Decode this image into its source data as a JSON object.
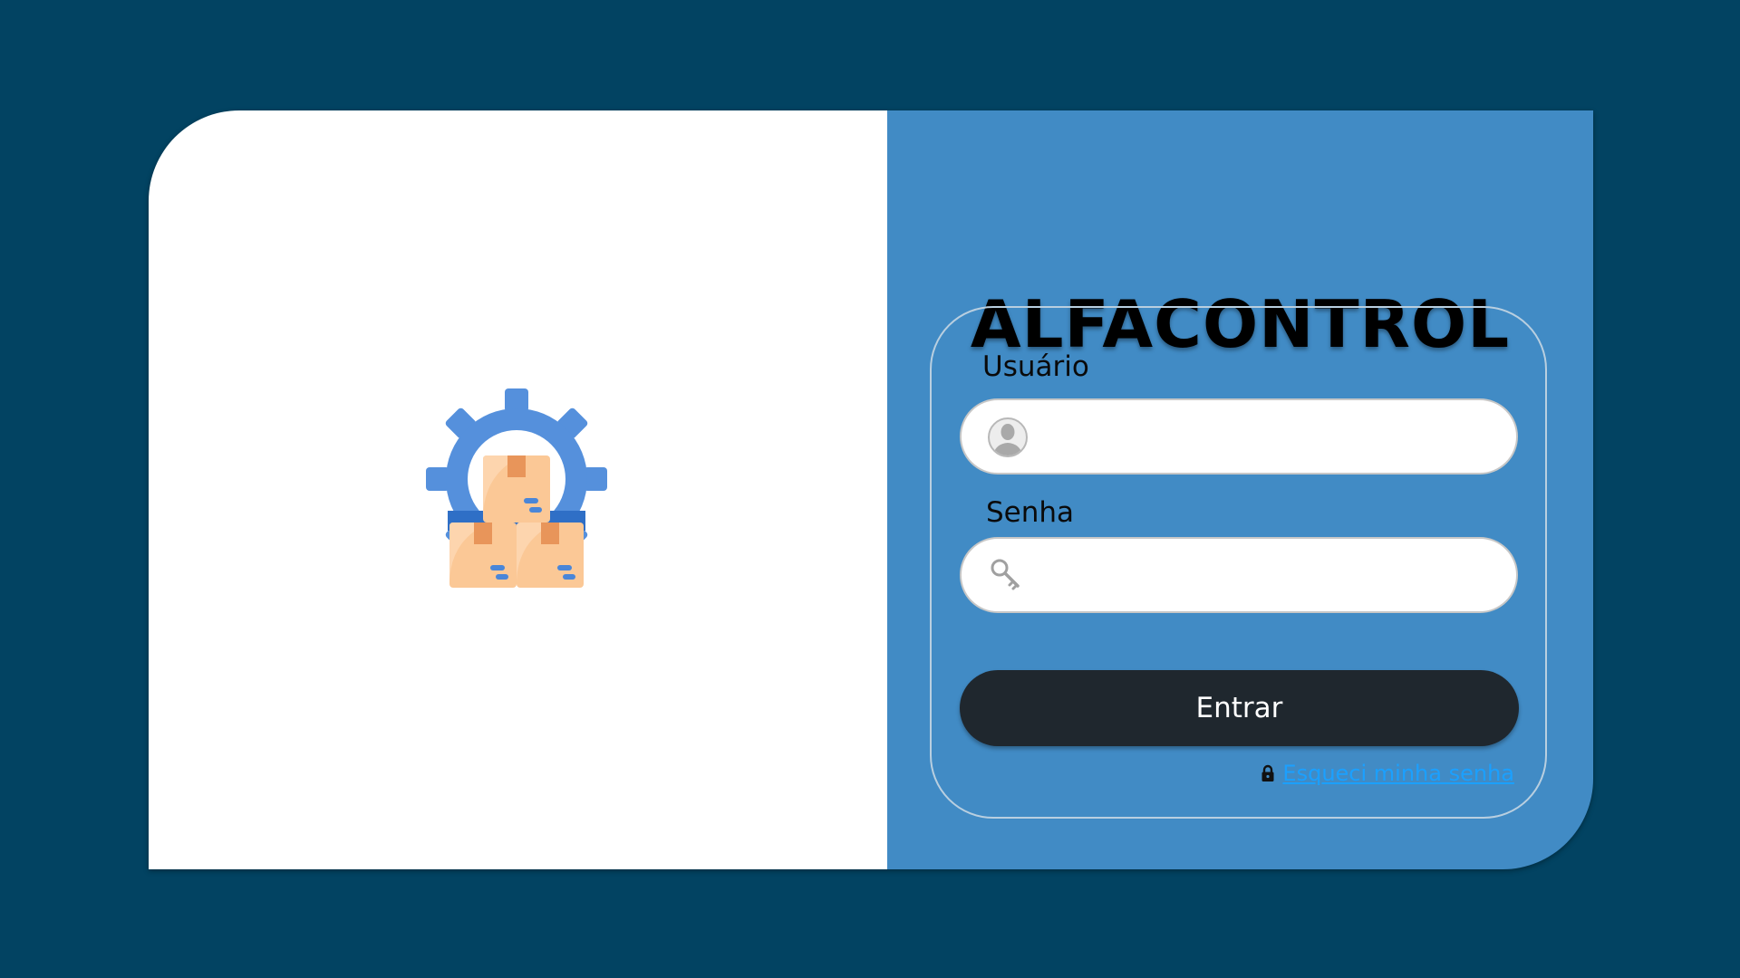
{
  "app": {
    "title": "ALFACONTROL"
  },
  "form": {
    "username_label": "Usuário",
    "username_value": "",
    "password_label": "Senha",
    "password_value": "",
    "submit_label": "Entrar",
    "forgot_label": "Esqueci minha senha"
  },
  "icons": {
    "logo": "gear-with-boxes-icon",
    "username": "user-avatar-icon",
    "password": "key-icon",
    "forgot": "lock-icon"
  },
  "colors": {
    "background": "#024362",
    "right_panel": "#418bc5",
    "left_panel": "#ffffff",
    "button": "#1f272e",
    "link": "#1ba0ff"
  }
}
